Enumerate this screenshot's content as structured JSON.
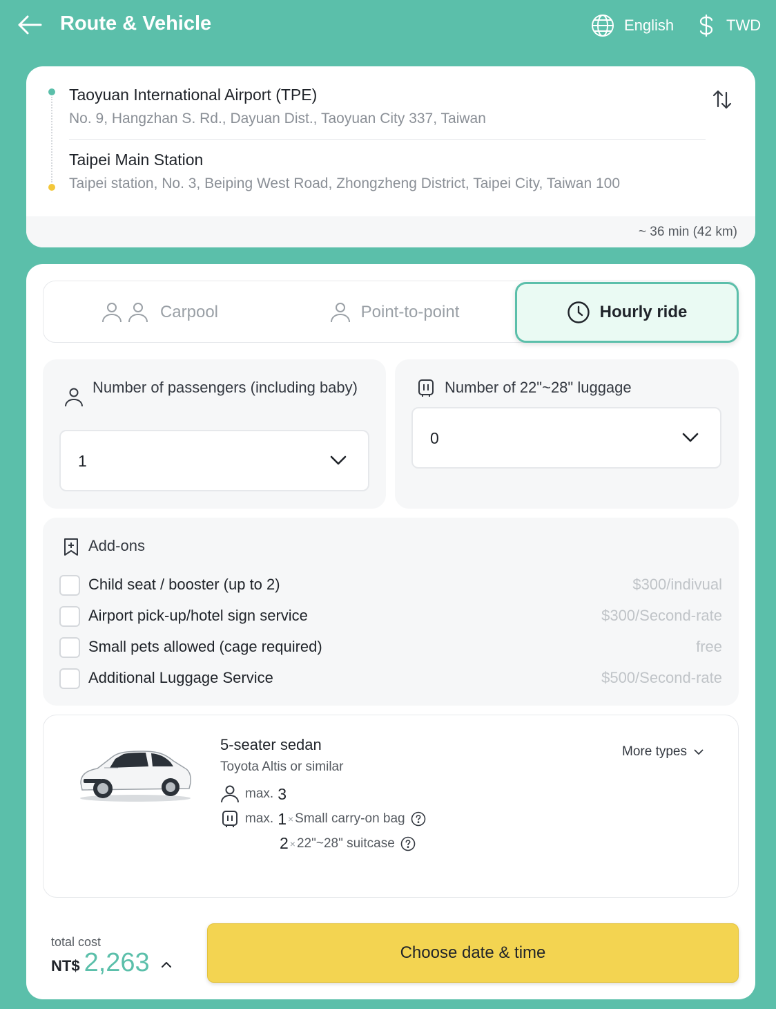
{
  "header": {
    "title": "Route & Vehicle",
    "language": "English",
    "currency": "TWD"
  },
  "route": {
    "origin": {
      "name": "Taoyuan International Airport (TPE)",
      "address": "No. 9, Hangzhan S. Rd., Dayuan Dist., Taoyuan City 337, Taiwan"
    },
    "destination": {
      "name": "Taipei Main Station",
      "address": "Taipei station, No. 3, Beiping West Road, Zhongzheng District, Taipei City, Taiwan 100"
    },
    "duration": "~ 36 min (42 km)"
  },
  "mode_tabs": [
    {
      "label": "Carpool",
      "active": false
    },
    {
      "label": "Point-to-point",
      "active": false
    },
    {
      "label": "Hourly ride",
      "active": true
    }
  ],
  "passengers": {
    "label": "Number of passengers (including baby)",
    "value": "1"
  },
  "luggage": {
    "label": "Number of 22\"~28\" luggage",
    "value": "0"
  },
  "addons": {
    "title": "Add-ons",
    "items": [
      {
        "label": "Child seat / booster (up to 2)",
        "price": "$300/indivual",
        "checked": false
      },
      {
        "label": "Airport pick-up/hotel sign service",
        "price": "$300/Second-rate",
        "checked": false
      },
      {
        "label": "Small pets allowed (cage required)",
        "price": "free",
        "checked": false
      },
      {
        "label": "Additional Luggage Service",
        "price": "$500/Second-rate",
        "checked": false
      }
    ]
  },
  "vehicle": {
    "name": "5-seater sedan",
    "model": "Toyota Altis or similar",
    "more_types": "More types",
    "max_label": "max.",
    "max_passengers": "3",
    "luggage": [
      {
        "count": "1",
        "sep": "×",
        "label": "Small carry-on bag"
      },
      {
        "count": "2",
        "sep": "×",
        "label": "22\"~28\" suitcase"
      }
    ]
  },
  "footer": {
    "total_label": "total cost",
    "currency_code": "NT$",
    "amount": "2,263",
    "cta": "Choose date & time"
  },
  "colors": {
    "accent": "#5bbfaa",
    "cta": "#f3d451",
    "origin_dot": "#5bbfaa",
    "destination_dot": "#f3c73a"
  }
}
